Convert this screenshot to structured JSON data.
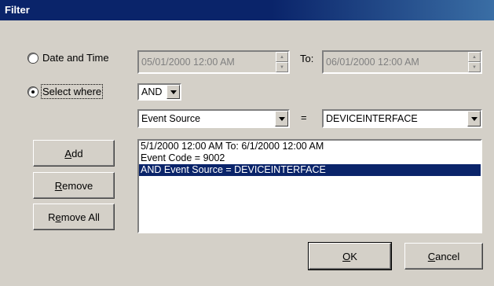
{
  "window": {
    "title": "Filter"
  },
  "date_time": {
    "label": "Date and Time",
    "from_value": "05/01/2000  12:00 AM",
    "to_label": "To:",
    "to_value": "06/01/2000  12:00 AM"
  },
  "select_where": {
    "label": "Select where",
    "logic_value": "AND",
    "field_value": "Event Source",
    "equals": "=",
    "match_value": "DEVICEINTERFACE"
  },
  "buttons": {
    "add": {
      "pre": "",
      "key": "A",
      "post": "dd"
    },
    "remove": {
      "pre": "",
      "key": "R",
      "post": "emove"
    },
    "remove_all": {
      "pre": "R",
      "key": "e",
      "post": "move All"
    },
    "ok": {
      "pre": "",
      "key": "O",
      "post": "K"
    },
    "cancel": {
      "pre": "",
      "key": "C",
      "post": "ancel"
    }
  },
  "criteria": [
    "5/1/2000 12:00 AM To: 6/1/2000 12:00 AM",
    "Event Code = 9002",
    "AND Event Source = DEVICEINTERFACE"
  ]
}
